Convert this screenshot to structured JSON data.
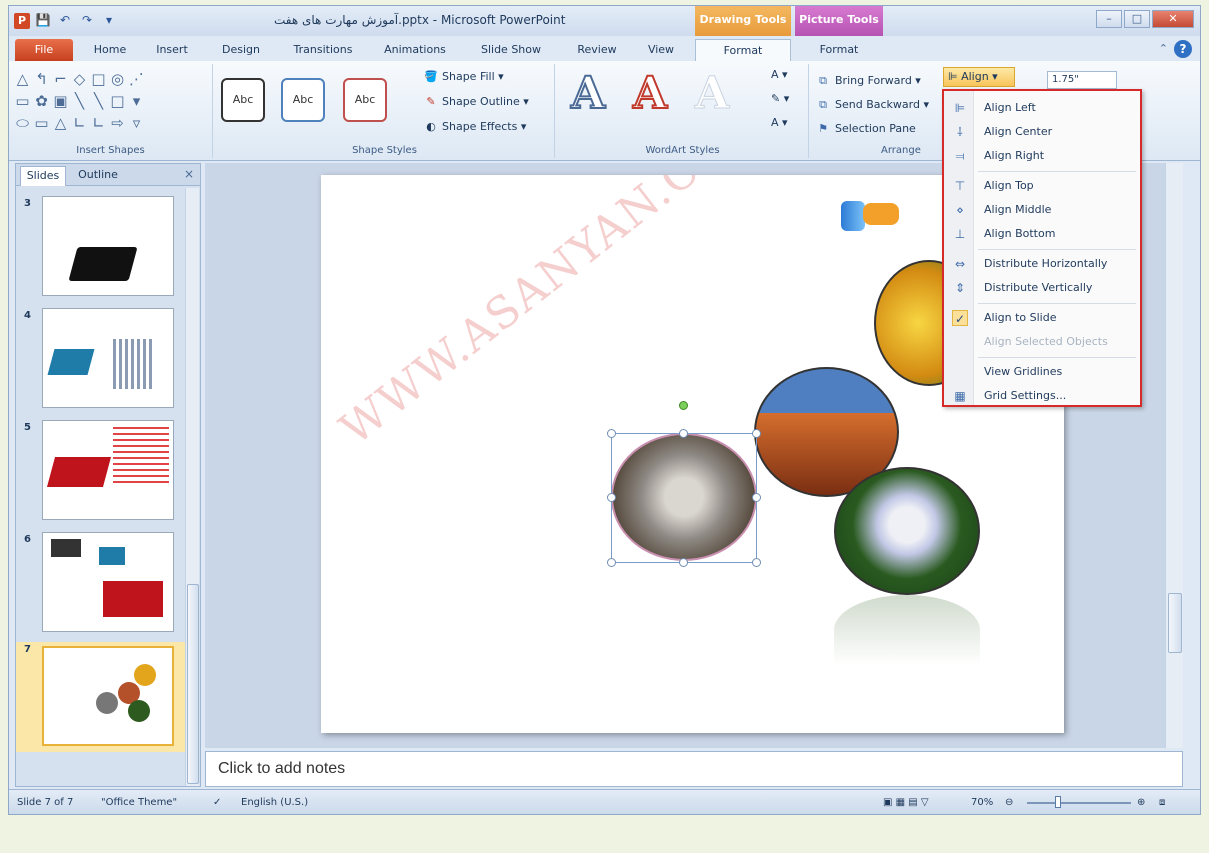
{
  "titlebar": {
    "title": "آموزش مهارت های هفت.pptx - Microsoft PowerPoint",
    "app_icon": "P",
    "contextual_tabs": [
      "Drawing Tools",
      "Picture Tools"
    ]
  },
  "tabs": [
    "File",
    "Home",
    "Insert",
    "Design",
    "Transitions",
    "Animations",
    "Slide Show",
    "Review",
    "View",
    "Format",
    "Format"
  ],
  "ribbon": {
    "groups": {
      "insert_shapes": "Insert Shapes",
      "shape_styles": "Shape Styles",
      "wordart_styles": "WordArt Styles",
      "arrange": "Arrange"
    },
    "abc_label": "Abc",
    "shape_fill": "Shape Fill",
    "shape_outline": "Shape Outline",
    "shape_effects": "Shape Effects",
    "bring_forward": "Bring Forward",
    "send_backward": "Send Backward",
    "selection_pane": "Selection Pane",
    "align": "Align",
    "size_value": "1.75\""
  },
  "align_menu": {
    "items": [
      {
        "label": "Align Left",
        "icon": "align-left-icon"
      },
      {
        "label": "Align Center",
        "icon": "align-center-icon"
      },
      {
        "label": "Align Right",
        "icon": "align-right-icon"
      },
      {
        "label": "Align Top",
        "icon": "align-top-icon"
      },
      {
        "label": "Align Middle",
        "icon": "align-middle-icon"
      },
      {
        "label": "Align Bottom",
        "icon": "align-bottom-icon"
      },
      {
        "label": "Distribute Horizontally",
        "icon": "distribute-horizontal-icon"
      },
      {
        "label": "Distribute Vertically",
        "icon": "distribute-vertical-icon"
      },
      {
        "label": "Align to Slide",
        "icon": "checkmark-icon",
        "checked": true
      },
      {
        "label": "Align Selected Objects",
        "disabled": true
      },
      {
        "label": "View Gridlines"
      },
      {
        "label": "Grid Settings...",
        "icon": "grid-icon"
      }
    ]
  },
  "left_pane": {
    "tabs": [
      "Slides",
      "Outline"
    ],
    "close": "×",
    "slides": [
      "3",
      "4",
      "5",
      "6",
      "7"
    ],
    "selected_slide": "7"
  },
  "slide": {
    "watermark": "WWW.ASANYAN.CO"
  },
  "notes": {
    "placeholder": "Click to add notes"
  },
  "statusbar": {
    "slide_info": "Slide 7 of 7",
    "theme": "\"Office Theme\"",
    "language": "English (U.S.)",
    "zoom": "70%"
  }
}
